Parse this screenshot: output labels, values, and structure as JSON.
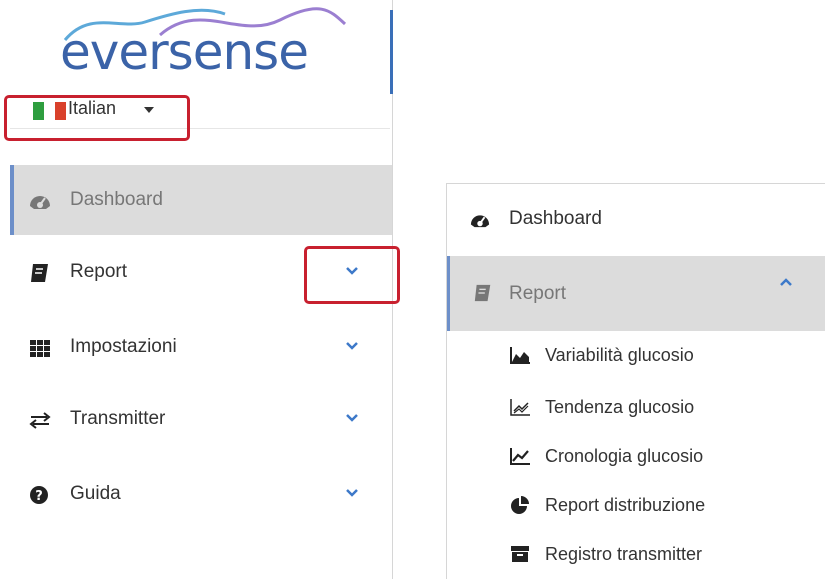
{
  "brand": {
    "logo_text": "eversense",
    "accent_color": "#3b63a8"
  },
  "language": {
    "label": "Italian",
    "flag_colors": [
      "#2e9e3f",
      "#ffffff",
      "#d9412b"
    ]
  },
  "highlight_color": "#c8202f",
  "left_nav": {
    "items": [
      {
        "label": "Dashboard",
        "icon": "dashboard-icon",
        "active": true,
        "has_chevron": false
      },
      {
        "label": "Report",
        "icon": "book-icon",
        "active": false,
        "has_chevron": true
      },
      {
        "label": "Impostazioni",
        "icon": "grid-icon",
        "active": false,
        "has_chevron": true
      },
      {
        "label": "Transmitter",
        "icon": "exchange-icon",
        "active": false,
        "has_chevron": true
      },
      {
        "label": "Guida",
        "icon": "question-circle-icon",
        "active": false,
        "has_chevron": true
      }
    ]
  },
  "right_nav": {
    "dashboard_label": "Dashboard",
    "report_label": "Report",
    "report_expanded": true,
    "sub_items": [
      {
        "label": "Variabilità glucosio",
        "icon": "area-chart-icon"
      },
      {
        "label": "Tendenza glucosio",
        "icon": "trend-scatter-icon"
      },
      {
        "label": "Cronologia glucosio",
        "icon": "line-chart-icon"
      },
      {
        "label": "Report distribuzione",
        "icon": "pie-chart-icon"
      },
      {
        "label": "Registro transmitter",
        "icon": "archive-icon"
      }
    ]
  }
}
